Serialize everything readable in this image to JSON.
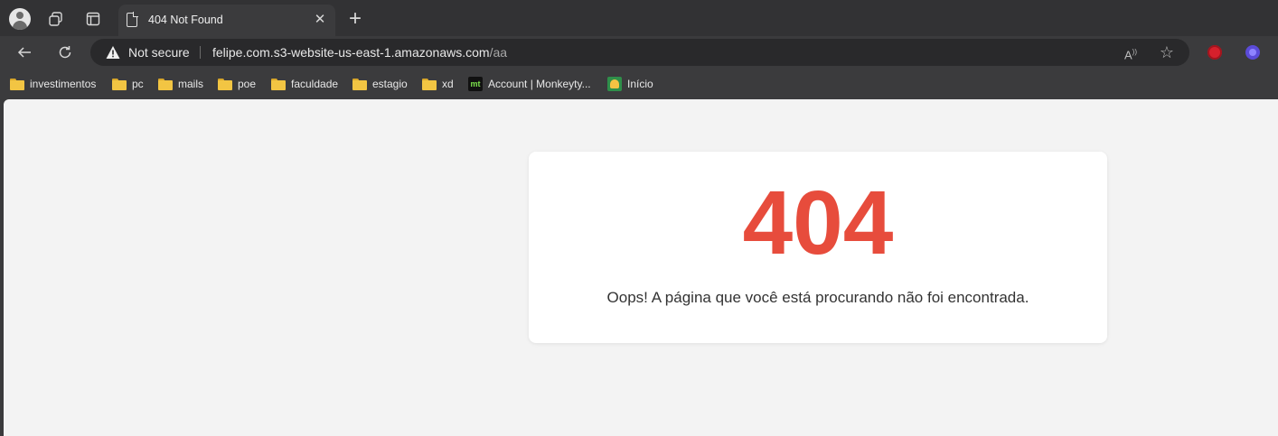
{
  "tab": {
    "title": "404 Not Found",
    "close_icon": "close-icon",
    "new_tab_icon": "plus-icon"
  },
  "address_bar": {
    "security_label": "Not secure",
    "url_host": "felipe.com.s3-website-us-east-1.amazonaws.com",
    "url_path": "/aa"
  },
  "bookmarks": [
    {
      "label": "investimentos",
      "icon": "folder-icon"
    },
    {
      "label": "pc",
      "icon": "folder-icon"
    },
    {
      "label": "mails",
      "icon": "folder-icon"
    },
    {
      "label": "poe",
      "icon": "folder-icon"
    },
    {
      "label": "faculdade",
      "icon": "folder-icon"
    },
    {
      "label": "estagio",
      "icon": "folder-icon"
    },
    {
      "label": "xd",
      "icon": "folder-icon"
    },
    {
      "label": "Account | Monkeyty...",
      "icon": "monkeytype-icon",
      "icon_text": "mt"
    },
    {
      "label": "Início",
      "icon": "classroom-icon"
    }
  ],
  "page": {
    "error_code": "404",
    "message": "Oops! A página que você está procurando não foi encontrada."
  },
  "colors": {
    "error_red": "#e74c3c",
    "page_bg": "#f3f3f3",
    "card_bg": "#ffffff"
  }
}
